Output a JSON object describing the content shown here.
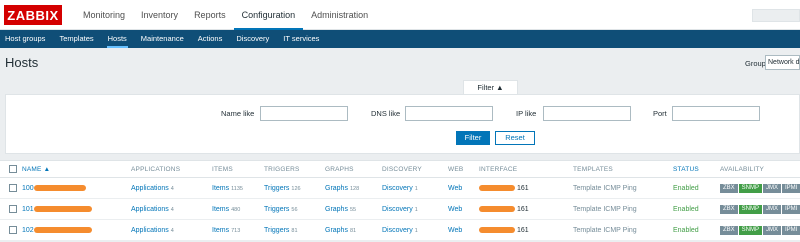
{
  "logo": "ZABBIX",
  "top_nav": [
    {
      "label": "Monitoring"
    },
    {
      "label": "Inventory"
    },
    {
      "label": "Reports"
    },
    {
      "label": "Configuration",
      "active": true
    },
    {
      "label": "Administration"
    }
  ],
  "sub_nav": [
    {
      "label": "Host groups"
    },
    {
      "label": "Templates"
    },
    {
      "label": "Hosts",
      "active": true
    },
    {
      "label": "Maintenance"
    },
    {
      "label": "Actions"
    },
    {
      "label": "Discovery"
    },
    {
      "label": "IT services"
    }
  ],
  "page": {
    "title": "Hosts",
    "group_label": "Group",
    "group_value": "Network devices"
  },
  "filter": {
    "tab_label": "Filter ▲",
    "name_label": "Name like",
    "dns_label": "DNS like",
    "ip_label": "IP like",
    "port_label": "Port",
    "name_value": "",
    "dns_value": "",
    "ip_value": "",
    "port_value": "",
    "apply_label": "Filter",
    "reset_label": "Reset"
  },
  "table": {
    "headers": {
      "name": "NAME ▲",
      "applications": "APPLICATIONS",
      "items": "ITEMS",
      "triggers": "TRIGGERS",
      "graphs": "GRAPHS",
      "discovery": "DISCOVERY",
      "web": "WEB",
      "interface": "INTERFACE",
      "templates": "TEMPLATES",
      "status": "STATUS",
      "availability": "AVAILABILITY"
    },
    "rows": [
      {
        "name": "100",
        "applications": "Applications",
        "applications_count": "4",
        "items": "Items",
        "items_count": "1135",
        "triggers": "Triggers",
        "triggers_count": "126",
        "graphs": "Graphs",
        "graphs_count": "128",
        "discovery": "Discovery",
        "discovery_count": "1",
        "web": "Web",
        "interface": "161",
        "template": "Template ICMP Ping",
        "status": "Enabled"
      },
      {
        "name": "101",
        "applications": "Applications",
        "applications_count": "4",
        "items": "Items",
        "items_count": "480",
        "triggers": "Triggers",
        "triggers_count": "56",
        "graphs": "Graphs",
        "graphs_count": "55",
        "discovery": "Discovery",
        "discovery_count": "1",
        "web": "Web",
        "interface": "161",
        "template": "Template ICMP Ping",
        "status": "Enabled"
      },
      {
        "name": "102",
        "applications": "Applications",
        "applications_count": "4",
        "items": "Items",
        "items_count": "713",
        "triggers": "Triggers",
        "triggers_count": "81",
        "graphs": "Graphs",
        "graphs_count": "81",
        "discovery": "Discovery",
        "discovery_count": "1",
        "web": "Web",
        "interface": "161",
        "template": "Template ICMP Ping",
        "status": "Enabled"
      }
    ],
    "availability_labels": [
      "ZBX",
      "SNMP",
      "JMX",
      "IPMI"
    ]
  },
  "colors": {
    "brand": "#d40000",
    "subnav": "#0f4e77",
    "accent": "#0275b8",
    "enabled": "#429e47"
  }
}
